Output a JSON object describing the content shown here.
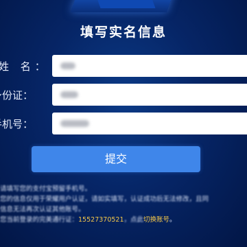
{
  "form": {
    "title": "填写实名信息",
    "fields": [
      {
        "label": "姓  名：",
        "value": ""
      },
      {
        "label": "身份证：",
        "value": ""
      },
      {
        "label": "手机号：",
        "value": ""
      }
    ],
    "submit_label": "提交"
  },
  "notes": {
    "line1": "请填写您的支付宝预留手机号。",
    "line2": "您的信息仅用于荣耀用户认证，请如实填写，认证成功后无法修改，且同",
    "line3": "信息无法再次认证其他账号。",
    "line4_prefix": "您当前登录的完美通行证：",
    "line4_account": "15527370521",
    "line4_suffix": "，点此",
    "line4_link": "切换账号",
    "line4_end": "。"
  }
}
